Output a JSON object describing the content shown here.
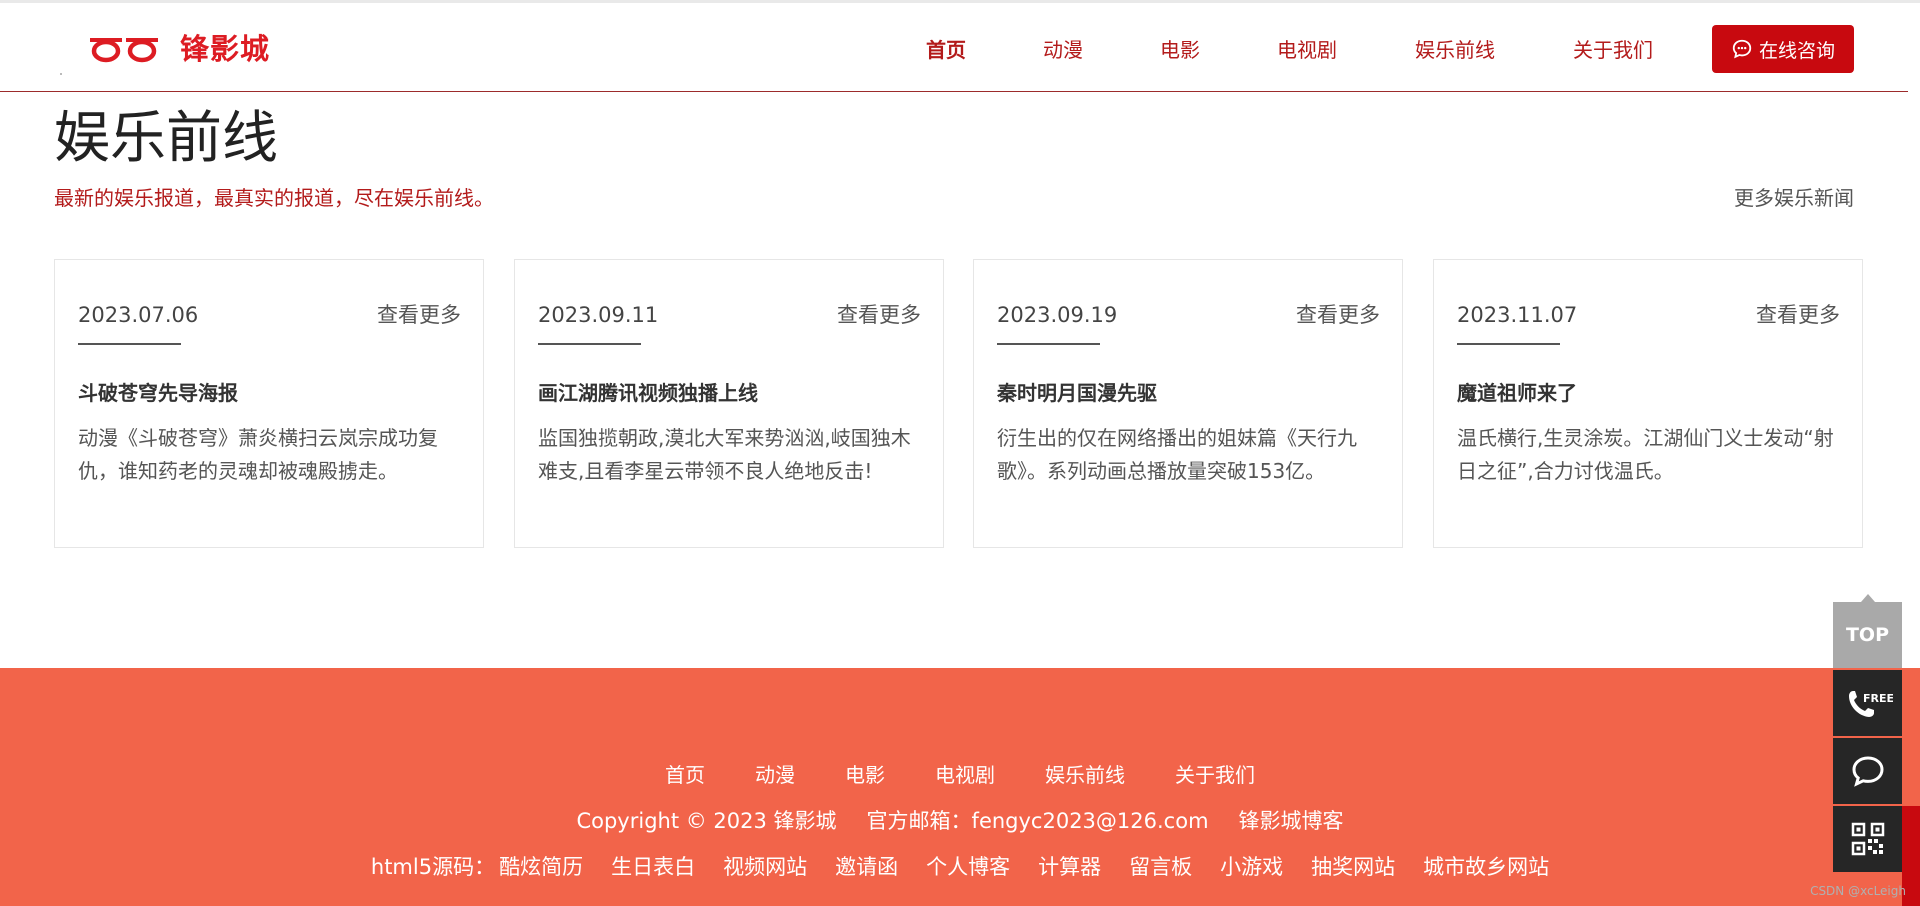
{
  "brand": {
    "name": "锋影城",
    "accent_color": "#dd1c23",
    "logo_icon": "double-ring-logo-icon"
  },
  "nav": {
    "items": [
      {
        "label": "首页",
        "active": true
      },
      {
        "label": "动漫",
        "active": false
      },
      {
        "label": "电影",
        "active": false
      },
      {
        "label": "电视剧",
        "active": false
      },
      {
        "label": "娱乐前线",
        "active": false
      },
      {
        "label": "关于我们",
        "active": false
      }
    ],
    "consult_label": "在线咨询",
    "consult_icon": "chat-bubble-icon",
    "consult_color": "#c8090f"
  },
  "section": {
    "title": "娱乐前线",
    "subtitle": "最新的娱乐报道，最真实的报道，尽在娱乐前线。",
    "more_label": "更多娱乐新闻"
  },
  "cards": [
    {
      "date": "2023.07.06",
      "more": "查看更多",
      "title": "斗破苍穹先导海报",
      "desc": "动漫《斗破苍穹》萧炎横扫云岚宗成功复仇，谁知药老的灵魂却被魂殿掳走。"
    },
    {
      "date": "2023.09.11",
      "more": "查看更多",
      "title": "画江湖腾讯视频独播上线",
      "desc": "监国独揽朝政,漠北大军来势汹汹,岐国独木难支,且看李星云带领不良人绝地反击!"
    },
    {
      "date": "2023.09.19",
      "more": "查看更多",
      "title": "秦时明月国漫先驱",
      "desc": "衍生出的仅在网络播出的姐妹篇《天行九歌》。系列动画总播放量突破153亿。"
    },
    {
      "date": "2023.11.07",
      "more": "查看更多",
      "title": "魔道祖师来了",
      "desc": "温氏横行,生灵涂炭。江湖仙门义士发动“射日之征”,合力讨伐温氏。"
    }
  ],
  "footer": {
    "background": "#f2644a",
    "nav": [
      "首页",
      "动漫",
      "电影",
      "电视剧",
      "娱乐前线",
      "关于我们"
    ],
    "copyright": "Copyright © 2023 锋影城",
    "email": "官方邮箱：fengyc2023@126.com",
    "blog": "锋影城博客",
    "links_prefix": "html5源码：",
    "links": [
      "酷炫简历",
      "生日表白",
      "视频网站",
      "邀请函",
      "个人博客",
      "计算器",
      "留言板",
      "小游戏",
      "抽奖网站",
      "城市故乡网站"
    ]
  },
  "side": {
    "top_label": "TOP",
    "buttons": [
      "phone-free-icon",
      "chat-bubble-icon",
      "qr-code-icon"
    ]
  },
  "watermark": "CSDN @xcLeigh"
}
